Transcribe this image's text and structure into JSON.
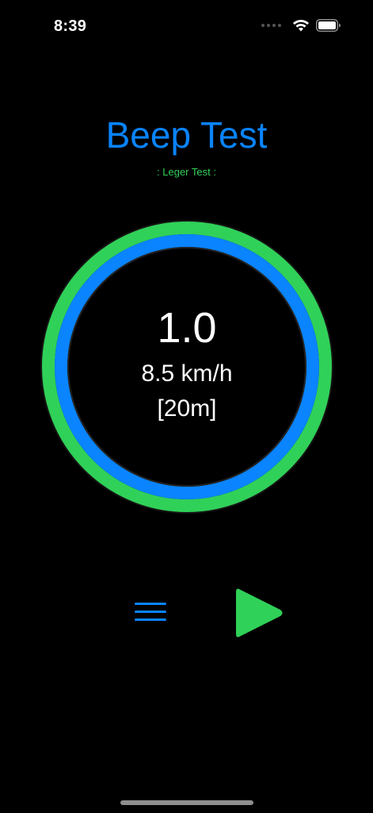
{
  "status_bar": {
    "time": "8:39",
    "icons": [
      "signal-dots-icon",
      "wifi-icon",
      "battery-icon"
    ]
  },
  "header": {
    "title": "Beep Test",
    "subtitle": ": Leger Test :"
  },
  "dial": {
    "level": "1.0",
    "speed": "8.5 km/h",
    "distance": "[20m]",
    "outer_progress": 1.0,
    "inner_progress": 1.0
  },
  "controls": {
    "menu_icon": "hamburger-menu-icon",
    "play_icon": "play-icon"
  },
  "colors": {
    "background": "#000000",
    "accent_blue": "#0a84ff",
    "accent_green": "#30d158",
    "text": "#ffffff"
  }
}
